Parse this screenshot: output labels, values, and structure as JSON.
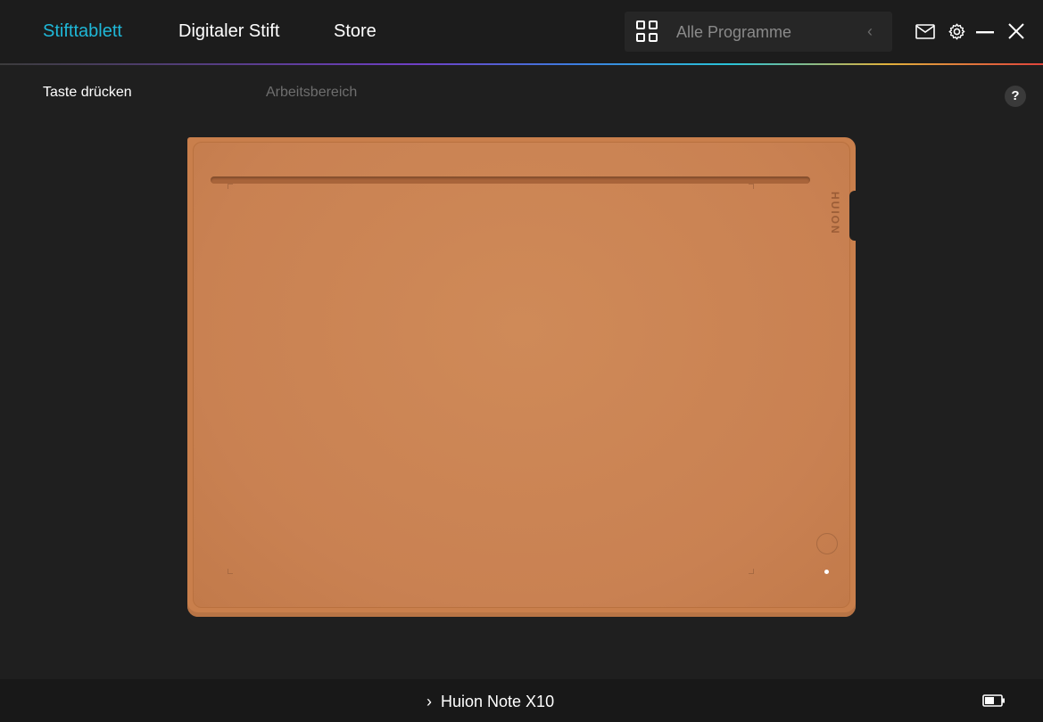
{
  "nav": {
    "tabs": [
      {
        "label": "Stifttablett",
        "active": true
      },
      {
        "label": "Digitaler Stift",
        "active": false
      },
      {
        "label": "Store",
        "active": false
      }
    ]
  },
  "program_filter": {
    "icon": "grid-icon",
    "placeholder": "Alle Programme",
    "collapse_icon": "chevron-left-icon"
  },
  "window_controls": [
    "mail-icon",
    "gear-icon",
    "minimize-icon",
    "close-icon"
  ],
  "subtabs": [
    {
      "label": "Taste drücken",
      "active": true
    },
    {
      "label": "Arbeitsbereich",
      "active": false
    }
  ],
  "help": {
    "label": "?"
  },
  "tablet": {
    "brand": "HUION",
    "color": "#c97f4c"
  },
  "status_bar": {
    "device_name": "Huion Note X10",
    "battery_icon": "battery-icon"
  },
  "colors": {
    "accent": "#1fb8d8",
    "background": "#1f1f1f"
  }
}
